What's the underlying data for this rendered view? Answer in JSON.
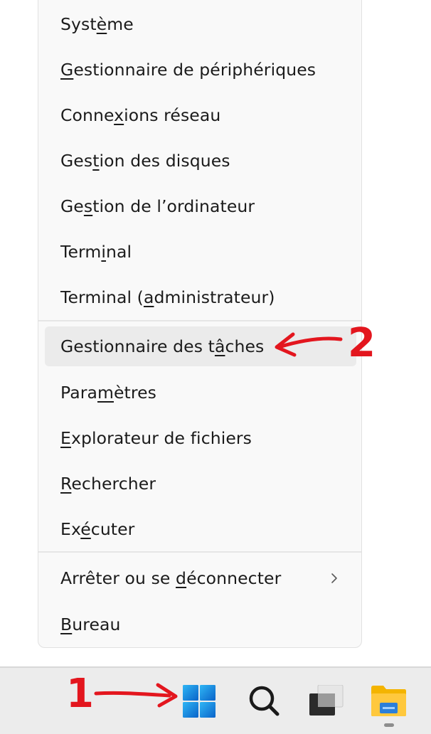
{
  "context_menu": {
    "items": [
      {
        "id": "systeme",
        "parts": [
          {
            "t": "Syst"
          },
          {
            "t": "è",
            "u": true
          },
          {
            "t": "me"
          }
        ]
      },
      {
        "id": "gestionnaire-peripheriques",
        "parts": [
          {
            "t": "G",
            "u": true
          },
          {
            "t": "estionnaire de périphériques"
          }
        ]
      },
      {
        "id": "connexions-reseau",
        "parts": [
          {
            "t": "Conne"
          },
          {
            "t": "x",
            "u": true
          },
          {
            "t": "ions réseau"
          }
        ]
      },
      {
        "id": "gestion-disques",
        "parts": [
          {
            "t": "Ges"
          },
          {
            "t": "t",
            "u": true
          },
          {
            "t": "ion des disques"
          }
        ]
      },
      {
        "id": "gestion-ordinateur",
        "parts": [
          {
            "t": "Ge"
          },
          {
            "t": "s",
            "u": true
          },
          {
            "t": "tion de l’ordinateur"
          }
        ]
      },
      {
        "id": "terminal",
        "parts": [
          {
            "t": "Term"
          },
          {
            "t": "i",
            "u": true
          },
          {
            "t": "nal"
          }
        ]
      },
      {
        "id": "terminal-admin",
        "parts": [
          {
            "t": "Terminal ("
          },
          {
            "t": "a",
            "u": true
          },
          {
            "t": "dministrateur)"
          }
        ]
      },
      {
        "id": "gestionnaire-taches",
        "highlighted": true,
        "parts": [
          {
            "t": "Gestionnaire des t"
          },
          {
            "t": "â",
            "u": true
          },
          {
            "t": "ches"
          }
        ]
      },
      {
        "id": "parametres",
        "parts": [
          {
            "t": "Para"
          },
          {
            "t": "m",
            "u": true
          },
          {
            "t": "ètres"
          }
        ]
      },
      {
        "id": "explorateur",
        "parts": [
          {
            "t": "E",
            "u": true
          },
          {
            "t": "xplorateur de fichiers"
          }
        ]
      },
      {
        "id": "rechercher",
        "parts": [
          {
            "t": "R",
            "u": true
          },
          {
            "t": "echercher"
          }
        ]
      },
      {
        "id": "executer",
        "parts": [
          {
            "t": "Ex"
          },
          {
            "t": "é",
            "u": true
          },
          {
            "t": "cuter"
          }
        ]
      },
      {
        "id": "arreter-deconnecter",
        "submenu": true,
        "parts": [
          {
            "t": "Arrêter ou se "
          },
          {
            "t": "d",
            "u": true
          },
          {
            "t": "éconnecter"
          }
        ]
      },
      {
        "id": "bureau",
        "parts": [
          {
            "t": "B",
            "u": true
          },
          {
            "t": "ureau"
          }
        ]
      }
    ]
  },
  "taskbar": {
    "icons": [
      "windows-start-icon",
      "search-icon",
      "task-view-icon",
      "file-explorer-icon"
    ]
  },
  "annotations": {
    "step1": "1",
    "step2": "2",
    "color": "#e3161e"
  }
}
